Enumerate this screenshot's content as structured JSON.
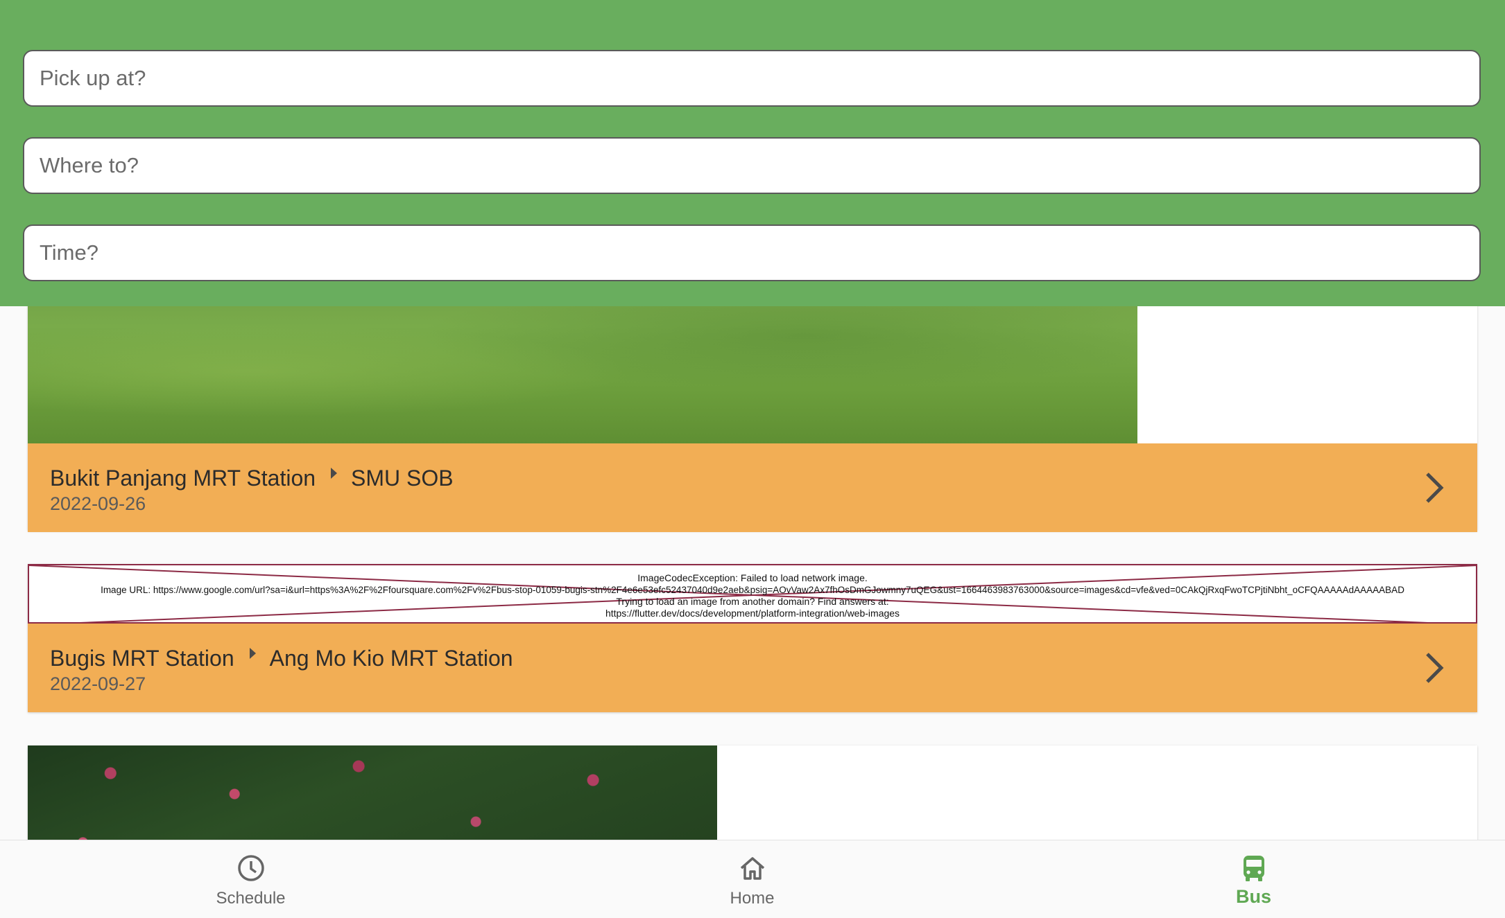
{
  "search": {
    "pickup_placeholder": "Pick up at?",
    "destination_placeholder": "Where to?",
    "time_placeholder": "Time?"
  },
  "trips": [
    {
      "from": "Bukit Panjang MRT Station",
      "to": "SMU SOB",
      "date": "2022-09-26"
    },
    {
      "error_title": "ImageCodecException: Failed to load network image.",
      "error_url": "Image URL: https://www.google.com/url?sa=i&url=https%3A%2F%2Ffoursquare.com%2Fv%2Fbus-stop-01059-bugis-stn%2F4e6e53efc52437040d9e2aeb&psig=AOvVaw2Ax7fhOsDmGJowmny7uQEG&ust=1664463983763000&source=images&cd=vfe&ved=0CAkQjRxqFwoTCPjtiNbht_oCFQAAAAAdAAAAABAD",
      "error_hint": "Trying to load an image from another domain? Find answers at:",
      "error_link": "https://flutter.dev/docs/development/platform-integration/web-images",
      "from": "Bugis MRT Station",
      "to": "Ang Mo Kio MRT Station",
      "date": "2022-09-27"
    }
  ],
  "nav": {
    "items": [
      {
        "label": "Schedule",
        "icon": "clock-icon"
      },
      {
        "label": "Home",
        "icon": "home-icon"
      },
      {
        "label": "Bus",
        "icon": "bus-icon"
      }
    ],
    "active": "Bus"
  },
  "colors": {
    "header": "#69ae5e",
    "card_bar": "#f2ae55",
    "active": "#5fa853",
    "error_border": "#8c2a45"
  }
}
